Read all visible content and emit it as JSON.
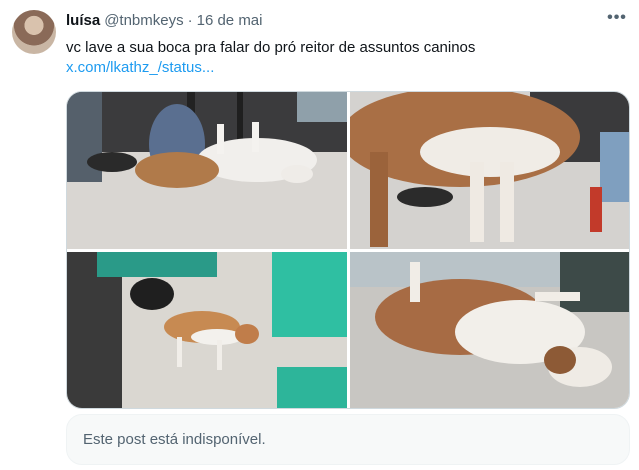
{
  "author": {
    "name": "luísa",
    "handle": "@tnbmkeys",
    "separator": "·",
    "date": "16 de mai"
  },
  "tweet": {
    "text": "vc lave a sua boca pra falar do pró reitor de assuntos caninos",
    "link": "x.com/lkathz_/status..."
  },
  "media": {
    "photos": [
      {
        "subject": "dog-lying-on-back"
      },
      {
        "subject": "dog-standing"
      },
      {
        "subject": "dog-lying-on-floor"
      },
      {
        "subject": "dog-rolling-on-floor"
      }
    ]
  },
  "quote": {
    "unavailable_text": "Este post está indisponível."
  },
  "icons": {
    "more": "more-dots-icon"
  },
  "colors": {
    "link": "#1d9bf0",
    "muted": "#536471"
  }
}
